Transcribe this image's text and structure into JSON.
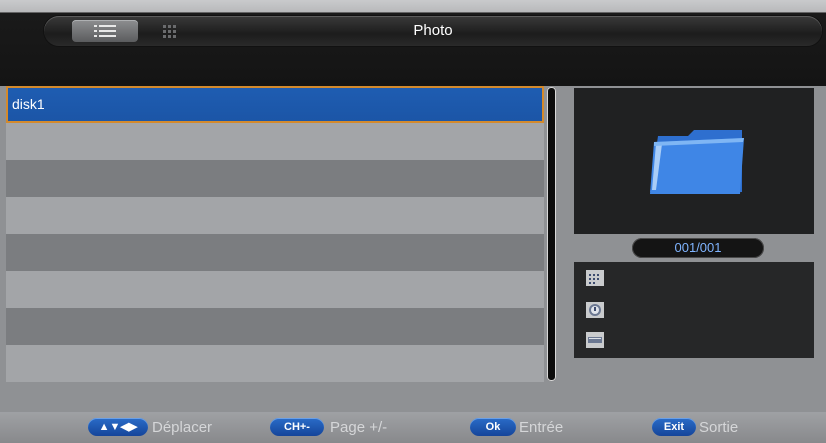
{
  "header": {
    "title": "Photo",
    "view_modes": [
      {
        "name": "list",
        "selected": true
      },
      {
        "name": "grid",
        "selected": false
      }
    ]
  },
  "file_list": {
    "items": [
      {
        "label": "disk1",
        "selected": true
      },
      {
        "label": "",
        "selected": false
      },
      {
        "label": "",
        "selected": false
      },
      {
        "label": "",
        "selected": false
      },
      {
        "label": "",
        "selected": false
      },
      {
        "label": "",
        "selected": false
      },
      {
        "label": "",
        "selected": false
      },
      {
        "label": "",
        "selected": false
      }
    ]
  },
  "preview": {
    "icon": "folder-icon",
    "counter": "001/001"
  },
  "info_panel": {
    "icons": [
      "resolution-icon",
      "date-icon",
      "size-icon"
    ]
  },
  "footer": {
    "hints": [
      {
        "key": "▲▼◀▶",
        "label": "Déplacer"
      },
      {
        "key": "CH+-",
        "label": "Page +/-"
      },
      {
        "key": "Ok",
        "label": "Entrée"
      },
      {
        "key": "Exit",
        "label": "Sortie"
      }
    ]
  },
  "colors": {
    "selection": "#1f5db2",
    "selection_border": "#d38a2d",
    "key_badge": "#2a6cc8",
    "counter_text": "#7fb4ff"
  }
}
